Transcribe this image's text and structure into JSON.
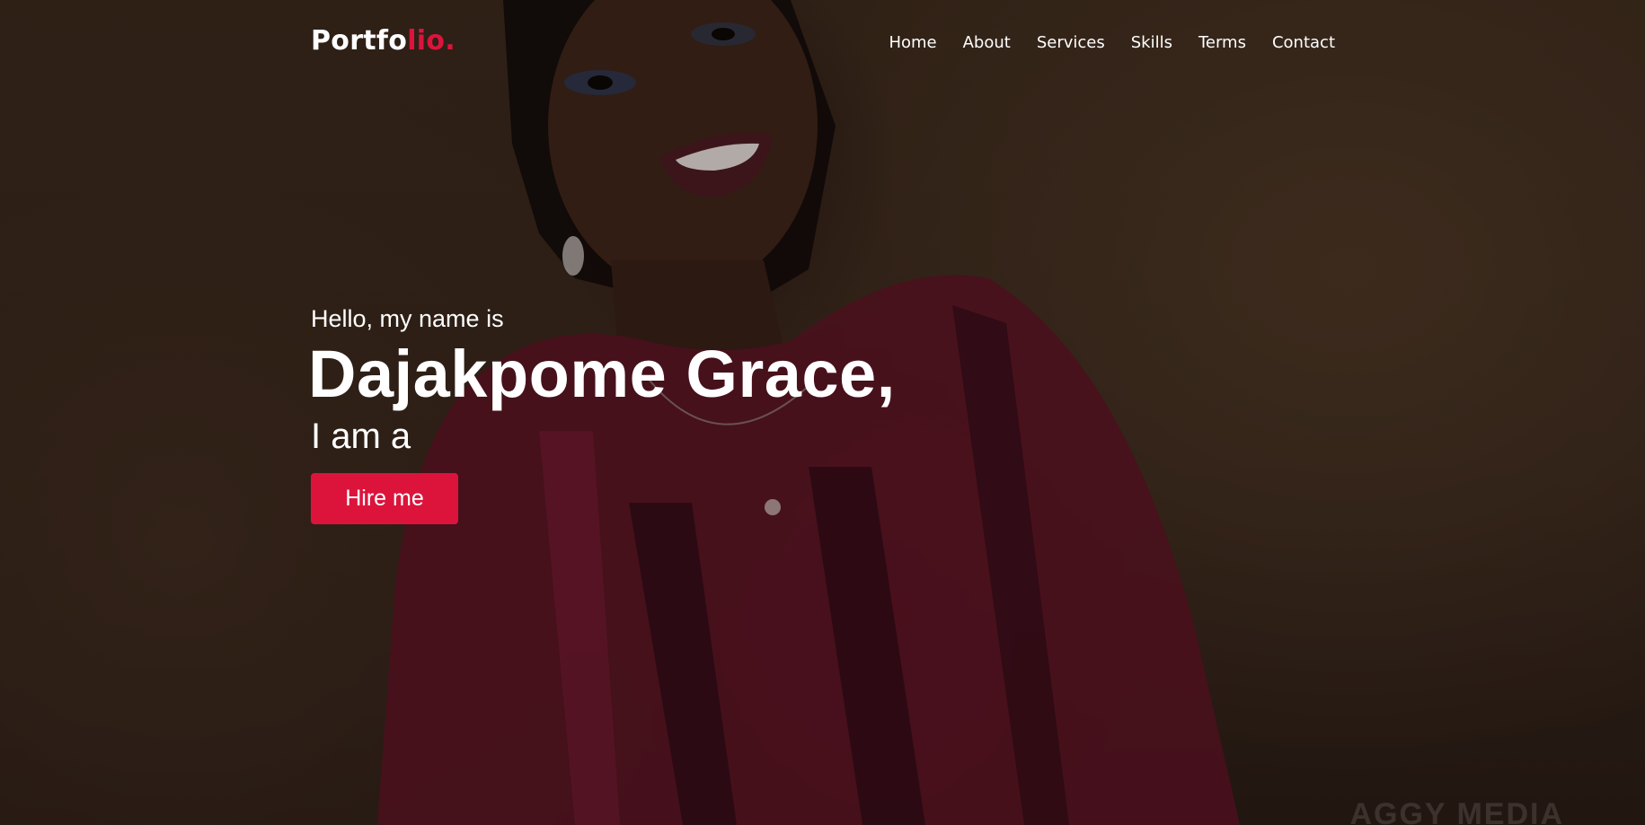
{
  "brand": {
    "logo_main": "Portfo",
    "logo_accent": "lio."
  },
  "nav": {
    "items": [
      {
        "label": "Home"
      },
      {
        "label": "About"
      },
      {
        "label": "Services"
      },
      {
        "label": "Skills"
      },
      {
        "label": "Terms"
      },
      {
        "label": "Contact"
      }
    ]
  },
  "hero": {
    "greeting": "Hello, my name is",
    "name": "Dajakpome Grace,",
    "role": "I am a",
    "cta_label": "Hire me",
    "watermark": "AGGY MEDIA"
  },
  "colors": {
    "accent": "#dc143c",
    "text": "#ffffff"
  }
}
